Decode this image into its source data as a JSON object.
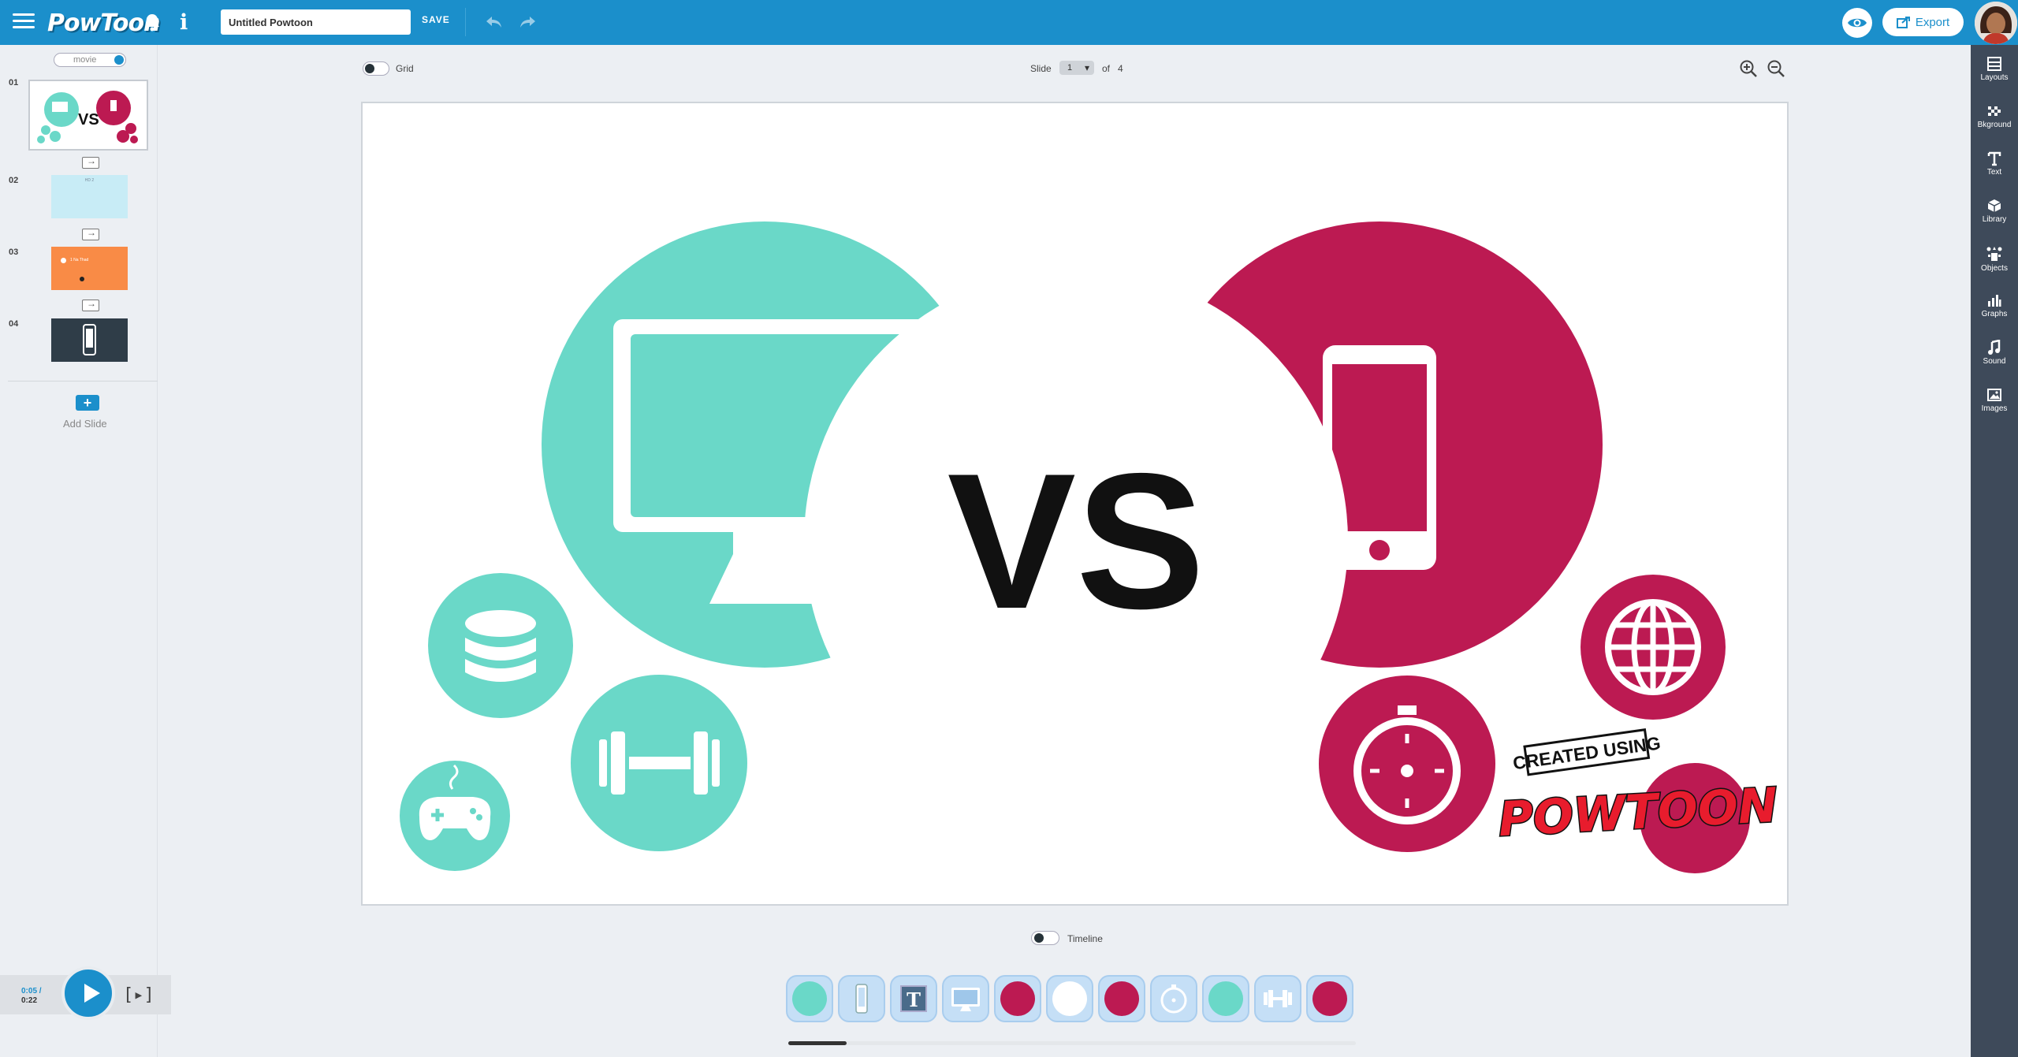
{
  "app": {
    "brand": "PowToon",
    "title_value": "Untitled Powtoon",
    "save_label": "SAVE",
    "export_label": "Export"
  },
  "left_panel": {
    "mode_toggle": "movie",
    "slides": [
      {
        "num": "01"
      },
      {
        "num": "02",
        "text": "HD 2"
      },
      {
        "num": "03",
        "text": "1 Na Thad"
      },
      {
        "num": "04"
      }
    ],
    "add_slide_label": "Add Slide"
  },
  "player": {
    "current": "0:05 /",
    "total": "0:22",
    "full_play": "[▸]"
  },
  "canvas_header": {
    "grid_label": "Grid",
    "slide_label": "Slide",
    "slide_value": "1",
    "of_label": "of",
    "total_slides": "4"
  },
  "slide": {
    "vs_text": "VS",
    "watermark_top": "CREATED USING",
    "watermark_brand": "POWTOON",
    "colors": {
      "teal": "#6ad8c8",
      "crimson": "#bc1a52",
      "black": "#111111"
    }
  },
  "timeline_label": "Timeline",
  "tray": [
    {
      "icon": "teal-circle-icon"
    },
    {
      "icon": "phone-icon"
    },
    {
      "icon": "text-icon",
      "text": "T"
    },
    {
      "icon": "monitor-icon"
    },
    {
      "icon": "crimson-circle-icon"
    },
    {
      "icon": "white-circle-icon"
    },
    {
      "icon": "crimson-circle-icon"
    },
    {
      "icon": "stopwatch-icon"
    },
    {
      "icon": "teal-circle-icon"
    },
    {
      "icon": "dumbbell-icon"
    },
    {
      "icon": "crimson-circle-icon"
    }
  ],
  "right_toolbar": [
    {
      "label": "Layouts",
      "icon": "layouts-icon"
    },
    {
      "label": "Bkground",
      "icon": "background-icon"
    },
    {
      "label": "Text",
      "icon": "text-icon"
    },
    {
      "label": "Library",
      "icon": "library-icon"
    },
    {
      "label": "Objects",
      "icon": "objects-icon"
    },
    {
      "label": "Graphs",
      "icon": "graphs-icon"
    },
    {
      "label": "Sound",
      "icon": "sound-icon"
    },
    {
      "label": "Images",
      "icon": "images-icon"
    }
  ]
}
